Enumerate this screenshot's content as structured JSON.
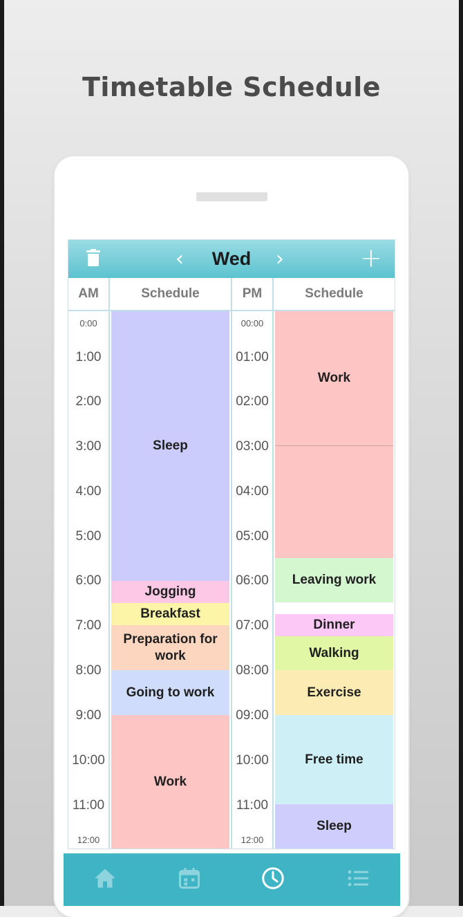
{
  "promo": {
    "title": "Timetable Schedule"
  },
  "toolbar": {
    "day": "Wed",
    "prev_icon": "chevron-left-icon",
    "next_icon": "chevron-right-icon",
    "add_icon": "plus-icon",
    "delete_icon": "trash-icon"
  },
  "headers": {
    "am": "AM",
    "am_schedule": "Schedule",
    "pm": "PM",
    "pm_schedule": "Schedule"
  },
  "am_times": [
    "0:00",
    "1:00",
    "2:00",
    "3:00",
    "4:00",
    "5:00",
    "6:00",
    "7:00",
    "8:00",
    "9:00",
    "10:00",
    "11:00",
    "12:00"
  ],
  "pm_times": [
    "00:00",
    "01:00",
    "02:00",
    "03:00",
    "04:00",
    "05:00",
    "06:00",
    "07:00",
    "08:00",
    "09:00",
    "10:00",
    "11:00",
    "12:00"
  ],
  "am_schedule": [
    {
      "label": "Sleep",
      "color": "#ccccfc"
    },
    {
      "label": "Jogging",
      "color": "#fcc8e6"
    },
    {
      "label": "Breakfast",
      "color": "#fcf5a8"
    },
    {
      "label": "Preparation for work",
      "color": "#fdd6c0"
    },
    {
      "label": "Going to work",
      "color": "#cfdcfb"
    },
    {
      "label": "Work",
      "color": "#fec5c5"
    }
  ],
  "pm_schedule": [
    {
      "label": "Work",
      "color": "#fec5c5"
    },
    {
      "label": "",
      "color": "#fec5c5"
    },
    {
      "label": "Leaving work",
      "color": "#d4f7d0"
    },
    {
      "label": "Dinner",
      "color": "#fcc9f7"
    },
    {
      "label": "Walking",
      "color": "#e1f7a6"
    },
    {
      "label": "Exercise",
      "color": "#fdebb4"
    },
    {
      "label": "Free time",
      "color": "#cdeff5"
    },
    {
      "label": "Sleep",
      "color": "#cfcdfb"
    }
  ],
  "tabs": [
    {
      "name": "home-icon"
    },
    {
      "name": "calendar-icon"
    },
    {
      "name": "clock-icon",
      "active": true
    },
    {
      "name": "list-icon"
    }
  ]
}
